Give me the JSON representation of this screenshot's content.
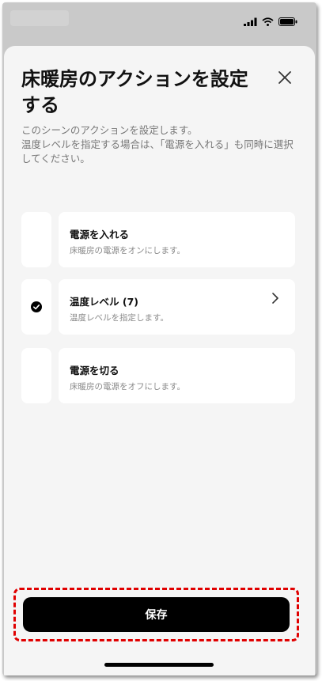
{
  "header": {
    "title": "床暖房のアクションを設定する",
    "description": "このシーンのアクションを設定します。\n温度レベルを指定する場合は、「電源を入れる」も同時に選択してください。"
  },
  "actions": [
    {
      "title": "電源を入れる",
      "subtitle": "床暖房の電源をオンにします。",
      "selected": false
    },
    {
      "title": "温度レベル (7)",
      "subtitle": "温度レベルを指定します。",
      "selected": true
    },
    {
      "title": "電源を切る",
      "subtitle": "床暖房の電源をオフにします。",
      "selected": false
    }
  ],
  "footer": {
    "save_label": "保存"
  },
  "colors": {
    "highlight": "#e00000",
    "primary_button": "#000000",
    "sheet_bg": "#f5f5f5"
  },
  "icons": {
    "close": "close-icon",
    "check": "check-icon",
    "chevron": "chevron-right-icon"
  }
}
